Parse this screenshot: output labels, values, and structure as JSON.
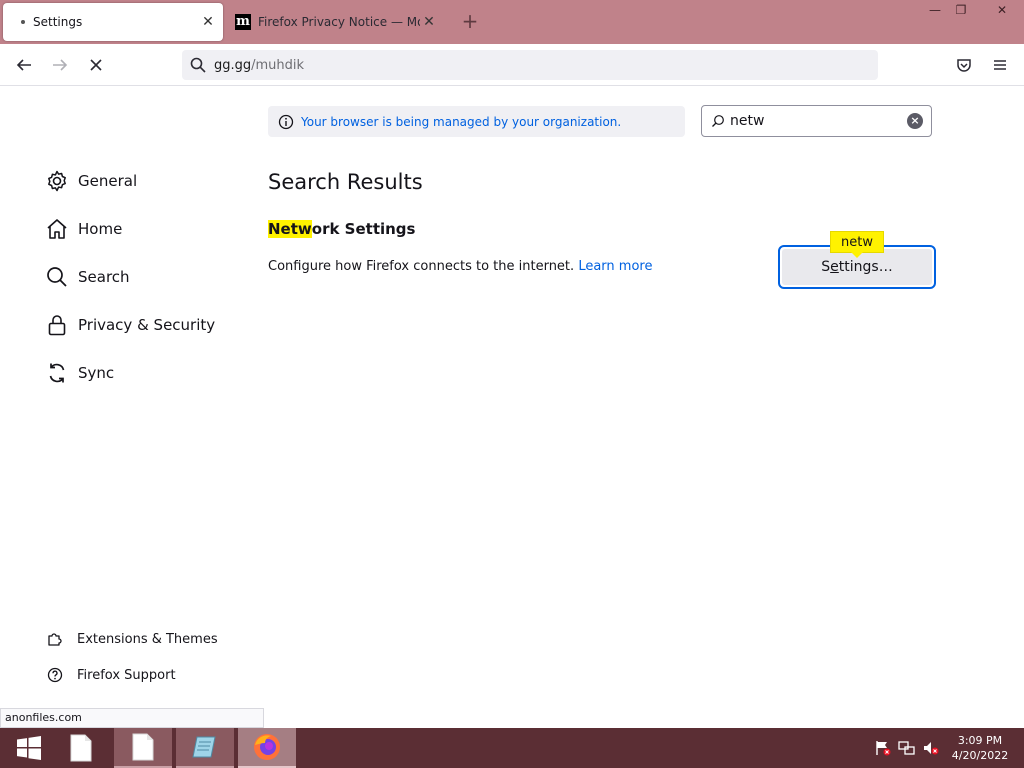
{
  "window": {
    "minimize_glyph": "—",
    "restore_glyph": "❐",
    "close_glyph": "✕"
  },
  "tabs": [
    {
      "title": "Settings",
      "close_glyph": "✕"
    },
    {
      "title": "Firefox Privacy Notice — Mozilla",
      "favicon_letter": "m",
      "close_glyph": "✕"
    }
  ],
  "new_tab_glyph": "+",
  "toolbar": {
    "url_host": "gg.gg",
    "url_path": "/muhdik"
  },
  "sidebar": {
    "categories": [
      {
        "label": "General",
        "icon": "gear-icon"
      },
      {
        "label": "Home",
        "icon": "home-icon"
      },
      {
        "label": "Search",
        "icon": "search-icon"
      },
      {
        "label": "Privacy & Security",
        "icon": "lock-icon"
      },
      {
        "label": "Sync",
        "icon": "sync-icon"
      }
    ],
    "footer": [
      {
        "label": "Extensions & Themes",
        "icon": "puzzle-icon"
      },
      {
        "label": "Firefox Support",
        "icon": "help-icon"
      }
    ]
  },
  "policy_banner": "Your browser is being managed by your organization.",
  "search": {
    "value": "netw",
    "clear_glyph": "×"
  },
  "results": {
    "title": "Search Results",
    "section_title_highlight": "Netw",
    "section_title_rest": "ork Settings",
    "description": "Configure how Firefox connects to the internet.",
    "learn_more": "Learn more",
    "button_pre": "S",
    "button_accel": "e",
    "button_post": "ttings…",
    "badge": "netw"
  },
  "status_url": "anonfiles.com",
  "taskbar": {
    "time": "3:09 PM",
    "date": "4/20/2022"
  },
  "colors": {
    "accent": "#0061e0",
    "highlight": "#fff200",
    "titlebar": "#c0828a",
    "taskbar": "#5b2e34"
  }
}
